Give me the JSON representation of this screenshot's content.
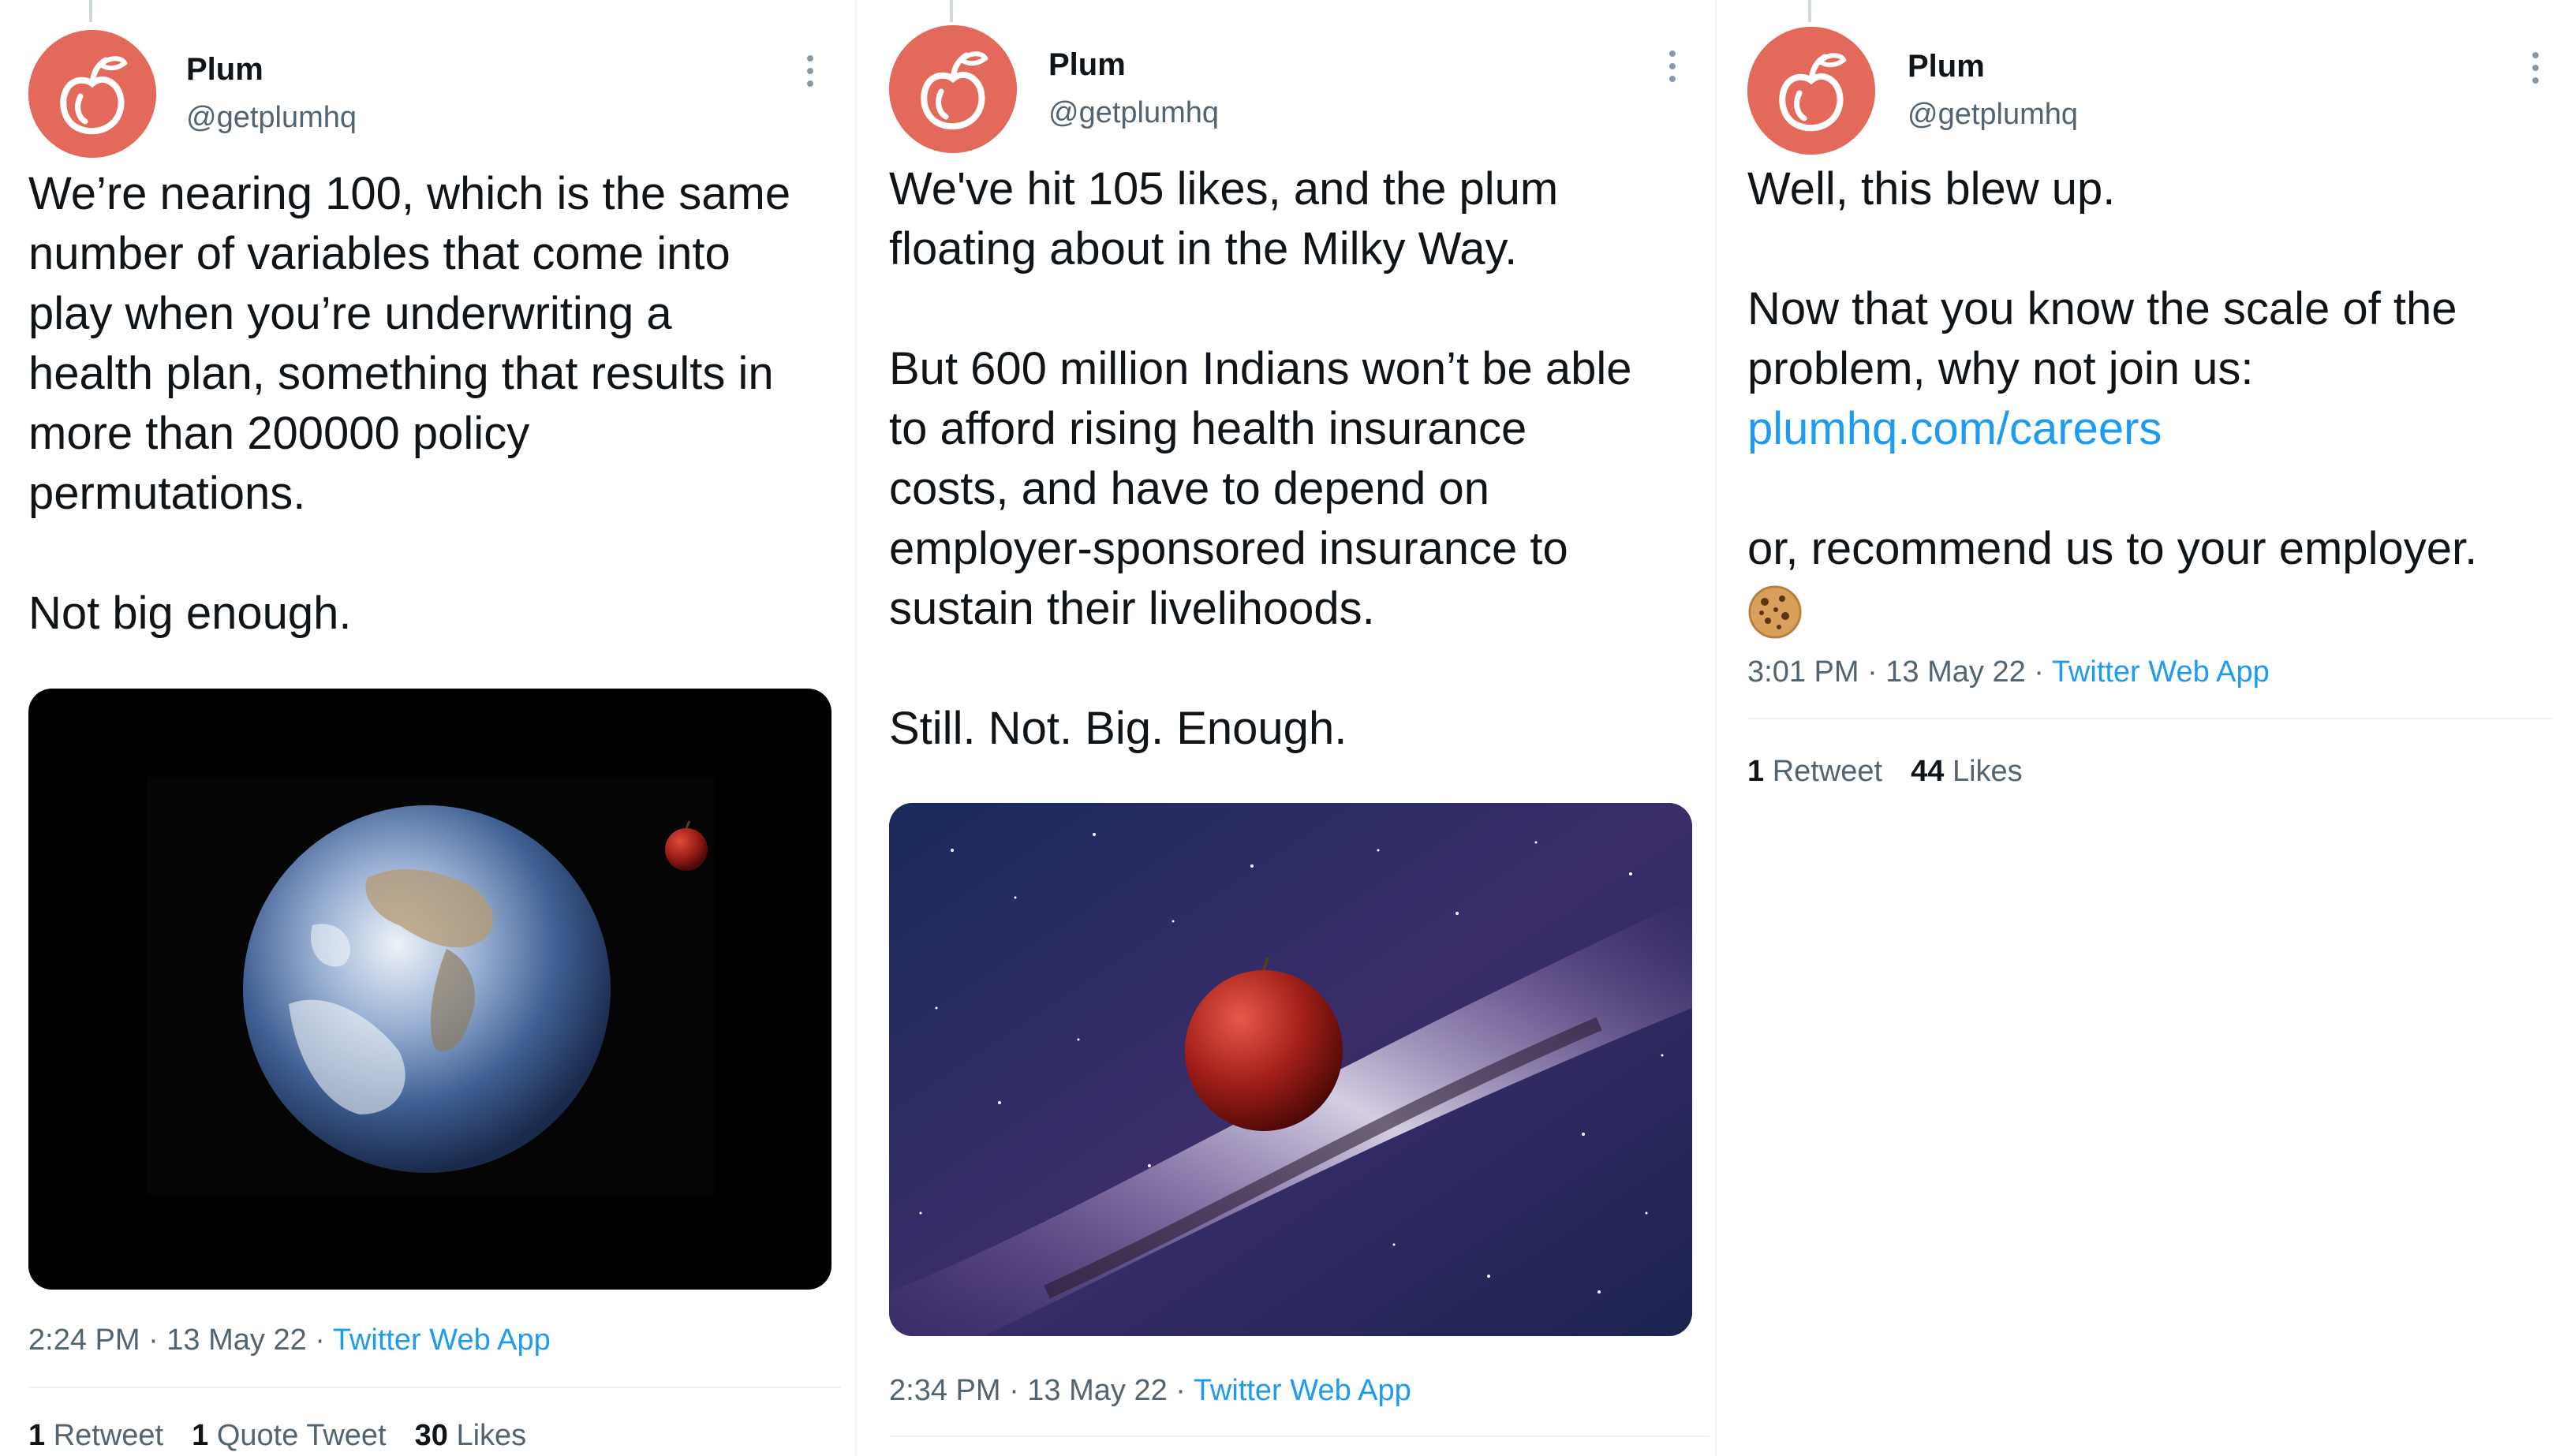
{
  "tweets": [
    {
      "author": "Plum",
      "handle": "@getplumhq",
      "text": "We’re nearing 100, which is the same\nnumber of variables that come into\nplay when you’re underwriting a\nhealth plan, something that results in\nmore than 200000 policy\npermutations.\n\nNot big enough.",
      "media_icon": "earth-and-plum-image",
      "time": "2:24 PM · 13 May 22 · ",
      "source": "Twitter Web App",
      "retweets": "1",
      "retweets_label": "Retweet",
      "quotes": "1",
      "quotes_label": "Quote Tweet",
      "likes": "30",
      "likes_label": "Likes"
    },
    {
      "author": "Plum",
      "handle": "@getplumhq",
      "text": "We've hit 105 likes, and the plum\nfloating about in the Milky Way.\n\nBut 600 million Indians won’t be able\nto afford rising health insurance\ncosts, and have to depend on\nemployer-sponsored insurance to\nsustain their livelihoods.\n\nStill. Not. Big. Enough.",
      "media_icon": "plum-in-milky-way-image",
      "time": "2:34 PM · 13 May 22 · ",
      "source": "Twitter Web App"
    },
    {
      "author": "Plum",
      "handle": "@getplumhq",
      "text_before": "Well, this blew up.\n\nNow that you know the scale of the\nproblem, why not join us:\n",
      "link": "plumhq.com/careers",
      "text_after": "\n\nor, recommend us to your employer.\n",
      "emoji_icon": "cookie-emoji",
      "time": "3:01 PM · 13 May 22 · ",
      "source": "Twitter Web App",
      "retweets": "1",
      "retweets_label": "Retweet",
      "likes": "44",
      "likes_label": "Likes"
    }
  ],
  "colors": {
    "avatar": "#e36a5b",
    "link": "#1d9bf0",
    "secondary_text": "#536471"
  }
}
